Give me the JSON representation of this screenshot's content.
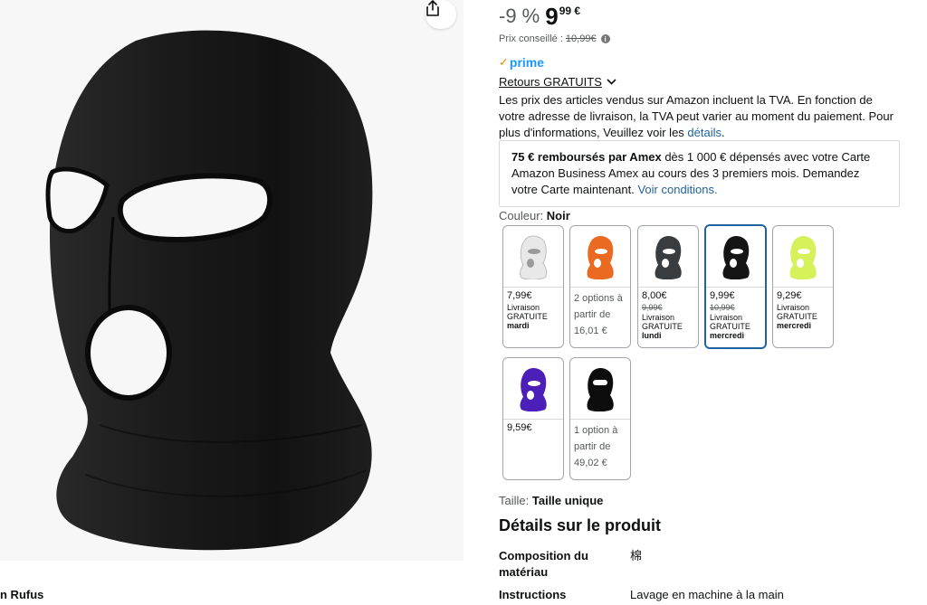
{
  "rufus": {
    "label": "n Rufus"
  },
  "price": {
    "discount": "-9 %",
    "whole": "9",
    "fraction": "99 €",
    "list_label": "Prix conseillé :",
    "list_value": "10,99€"
  },
  "prime": {
    "label": "prime"
  },
  "returns": {
    "label": "Retours GRATUITS"
  },
  "tva": {
    "text": "Les prix des articles vendus sur Amazon incluent la TVA. En fonction de votre adresse de livraison, la TVA peut varier au moment du paiement. Pour plus d'informations, Veuillez voir les ",
    "link": "détails",
    "end": "."
  },
  "amex": {
    "bold": "75 € remboursés par Amex",
    "text": " dès 1 000 € dépensés avec votre Carte Amazon Business Amex au cours des 3 premiers mois. Demandez votre Carte maintenant. ",
    "link": "Voir conditions."
  },
  "color": {
    "label": "Couleur:",
    "value": "Noir"
  },
  "swatches": [
    {
      "color": "white",
      "price": "7,99€",
      "line1": "Livraison GRATUITE",
      "day": "mardi"
    },
    {
      "color": "orange",
      "opt1": "2 options à",
      "opt2": "partir de",
      "opt3": "16,01 €"
    },
    {
      "color": "grey",
      "price": "8,00€",
      "strike": "9,99€",
      "line1": "Livraison GRATUITE",
      "day": "lundi"
    },
    {
      "color": "black",
      "price": "9,99€",
      "strike": "10,99€",
      "line1": "Livraison GRATUITE",
      "day": "mercredi"
    },
    {
      "color": "lime",
      "price": "9,29€",
      "line1": "Livraison GRATUITE",
      "day": "mercredi"
    },
    {
      "color": "purple",
      "price": "9,59€"
    },
    {
      "color": "black-1hole",
      "opt1": "1 option à",
      "opt2": "partir de",
      "opt3": "49,02 €"
    }
  ],
  "size": {
    "label": "Taille:",
    "value": "Taille unique"
  },
  "details": {
    "title": "Détails sur le produit",
    "rows": [
      {
        "key": "Composition du matériau",
        "value": "棉"
      },
      {
        "key": "Instructions",
        "value": "Lavage en machine à la main"
      }
    ]
  },
  "colors": {
    "link": "#2162a1",
    "prime": "#1a98ff",
    "selected_border": "#2162a1"
  }
}
